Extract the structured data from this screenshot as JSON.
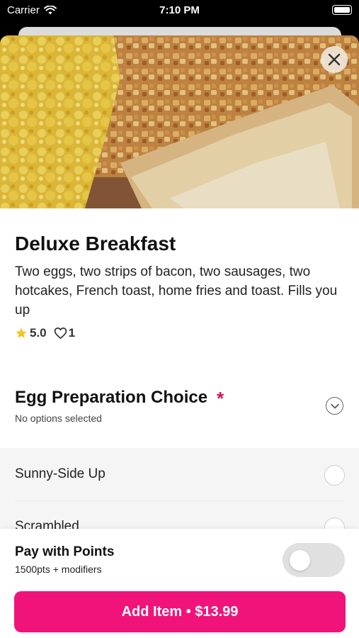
{
  "status_bar": {
    "carrier": "Carrier",
    "time": "7:10 PM"
  },
  "item": {
    "title": "Deluxe Breakfast",
    "description": "Two eggs, two strips of bacon, two sausages, two hotcakes, French toast, home fries and toast. Fills you up",
    "rating": "5.0",
    "likes": "1"
  },
  "modifier_group": {
    "title": "Egg Preparation Choice",
    "required_mark": "*",
    "subtitle": "No options selected",
    "options": [
      {
        "label": "Sunny-Side Up"
      },
      {
        "label": "Scrambled"
      }
    ]
  },
  "footer": {
    "points_title": "Pay with Points",
    "points_subtitle": "1500pts + modifiers",
    "add_button_label": "Add Item • $13.99"
  },
  "colors": {
    "accent": "#f0137a",
    "required": "#d6114f",
    "star": "#f5c518"
  },
  "icons": {
    "close": "close-icon",
    "star": "star-icon",
    "heart": "heart-icon",
    "chevron": "chevron-down-icon",
    "wifi": "wifi-icon",
    "battery": "battery-icon"
  }
}
